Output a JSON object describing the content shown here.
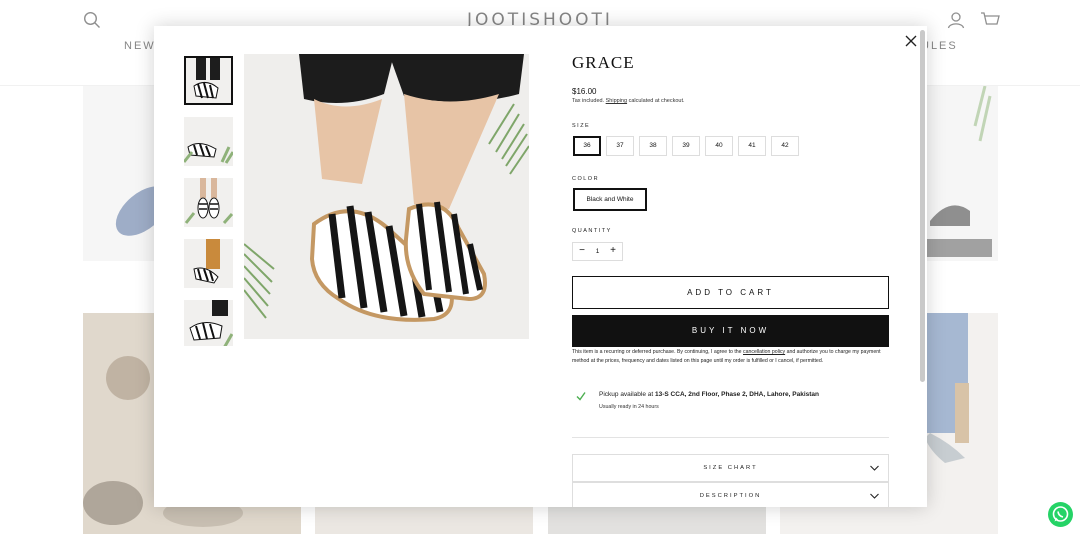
{
  "header": {
    "brand": "JOOTISHOOTI",
    "nav_left": "NEW",
    "nav_right": "ULES",
    "icons": [
      "search-icon",
      "account-icon",
      "cart-icon"
    ]
  },
  "modal": {
    "close_icon": "close-icon",
    "thumbnails": [
      "thumb-1",
      "thumb-2",
      "thumb-3",
      "thumb-4",
      "thumb-5"
    ],
    "product": {
      "title": "GRACE",
      "price": "$16.00",
      "tax_prefix": "Tax included.",
      "tax_link": "Shipping",
      "tax_suffix": "calculated at checkout.",
      "size_label": "SIZE",
      "sizes": [
        "36",
        "37",
        "38",
        "39",
        "40",
        "41",
        "42"
      ],
      "selected_size": "36",
      "color_label": "COLOR",
      "color_value": "Black and White",
      "quantity_label": "QUANTITY",
      "quantity": "1",
      "qty_minus": "−",
      "qty_plus": "+",
      "add_to_cart": "ADD TO CART",
      "buy_now": "BUY IT NOW",
      "policy_a": "This item is a recurring or deferred purchase. By continuing, I agree to the",
      "policy_link": "cancellation policy",
      "policy_b": "and authorize you to charge my payment method at the prices, frequency and dates listed on this page until my order is fulfilled or I cancel, if permitted.",
      "pickup_prefix": "Pickup available at",
      "pickup_location": "13-S CCA, 2nd Floor, Phase 2, DHA, Lahore, Pakistan",
      "pickup_sub": "Usually ready in 24 hours",
      "accordions": [
        "SIZE CHART",
        "DESCRIPTION"
      ]
    }
  },
  "colors": {
    "accent": "#111111",
    "check": "#4caf50",
    "whatsapp": "#25d366"
  }
}
